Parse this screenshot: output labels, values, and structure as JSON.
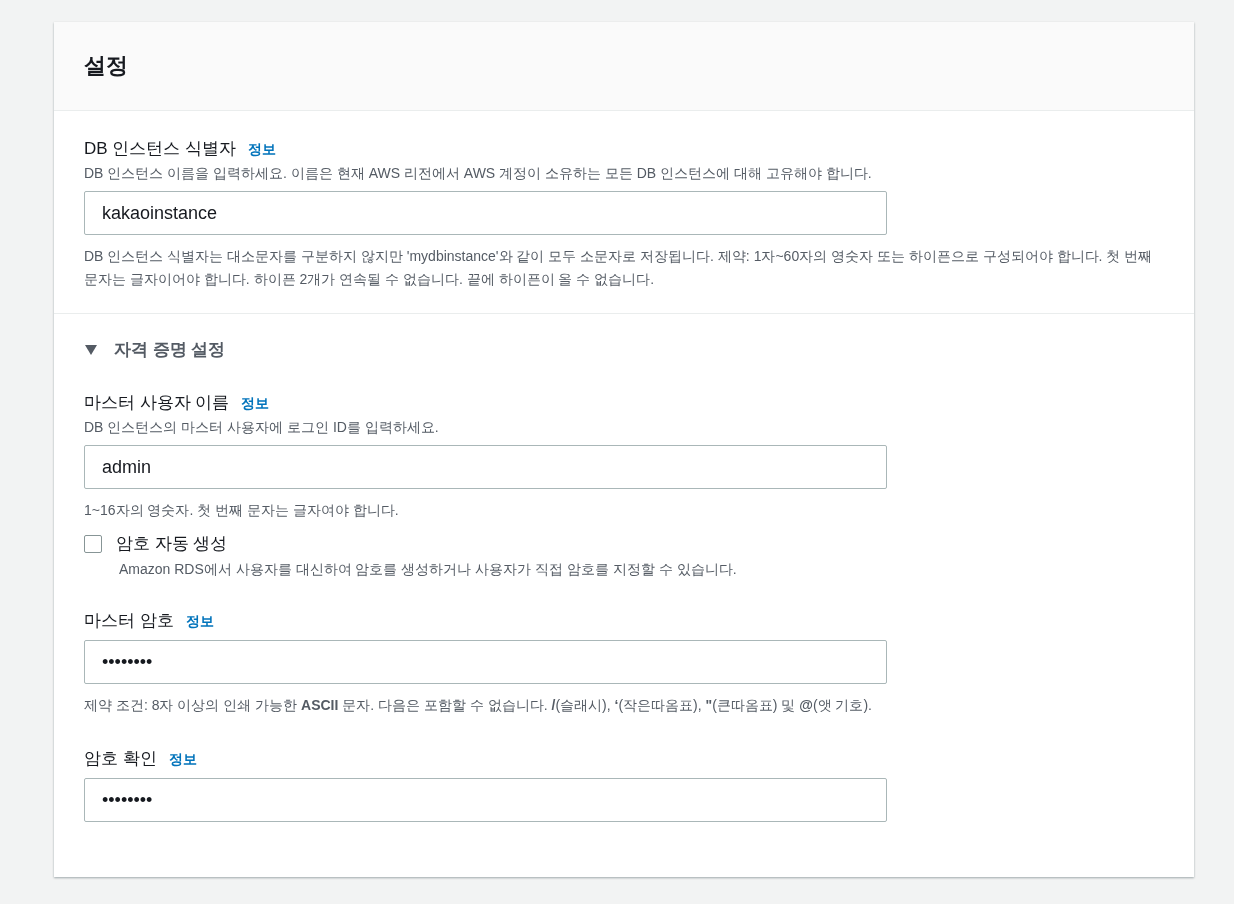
{
  "panel": {
    "title": "설정"
  },
  "identifier": [
    {
      "kind": "text",
      "label": "DB 인스턴스 식별자",
      "info_link": "정보",
      "description": "DB 인스턴스 이름을 입력하세요. 이름은 현재 AWS 리전에서 AWS 계정이 소유하는 모든 DB 인스턴스에 대해 고유해야 합니다.",
      "value": "kakaoinstance",
      "hint": "DB 인스턴스 식별자는 대소문자를 구분하지 않지만 'mydbinstance'와 같이 모두 소문자로 저장됩니다. 제약: 1자~60자의 영숫자 또는 하이픈으로 구성되어야 합니다. 첫 번째 문자는 글자이어야 합니다. 하이픈 2개가 연속될 수 없습니다. 끝에 하이픈이 올 수 없습니다."
    }
  ],
  "credentials": {
    "title": "자격 증명 설정",
    "expanded": true,
    "fields": [
      {
        "kind": "text",
        "label": "마스터 사용자 이름",
        "info_link": "정보",
        "description": "DB 인스턴스의 마스터 사용자에 로그인 ID를 입력하세요.",
        "value": "admin",
        "hint": "1~16자의 영숫자. 첫 번째 문자는 글자여야 합니다."
      },
      {
        "kind": "checkbox",
        "label": "암호 자동 생성",
        "checked": false,
        "description": "Amazon RDS에서 사용자를 대신하여 암호를 생성하거나 사용자가 직접 암호를 지정할 수 있습니다."
      },
      {
        "kind": "text",
        "label": "마스터 암호",
        "info_link": "정보",
        "value": "••••••••",
        "hint": "제약 조건: 8자 이상의 인쇄 가능한 **ASCII** 문자. 다음은 포함할 수 없습니다. **/**(슬래시), **‘**(작은따옴표), **\"**(큰따옴표) 및 **@**(앳 기호)."
      },
      {
        "kind": "text",
        "label": "암호 확인",
        "info_link": "정보",
        "value": "••••••••"
      }
    ]
  }
}
